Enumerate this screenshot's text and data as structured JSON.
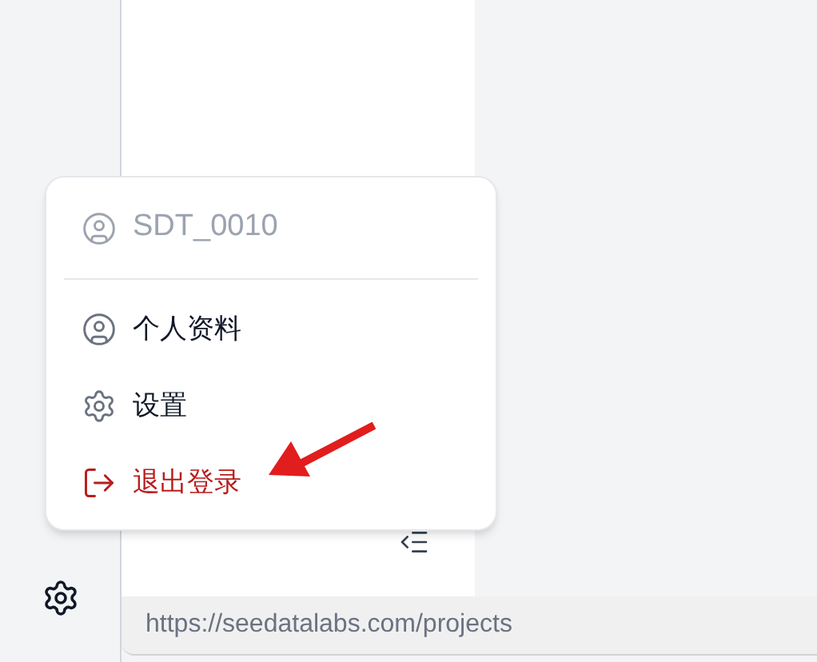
{
  "user_menu": {
    "username": "SDT_0010",
    "items": [
      {
        "kind": "profile",
        "label": "个人资料"
      },
      {
        "kind": "settings",
        "label": "设置"
      },
      {
        "kind": "logout",
        "label": "退出登录"
      }
    ]
  },
  "status_url": "https://seedatalabs.com/projects"
}
